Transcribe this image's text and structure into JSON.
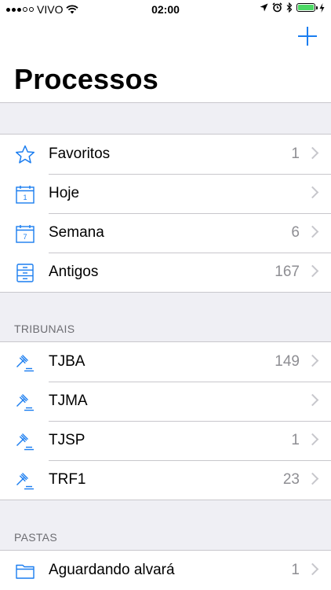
{
  "status_bar": {
    "carrier": "VIVO",
    "time": "02:00"
  },
  "nav": {
    "title": "Processos",
    "add_icon": "plus-icon"
  },
  "groups": {
    "main": [
      {
        "label": "Favoritos",
        "count": "1",
        "icon": "star-icon"
      },
      {
        "label": "Hoje",
        "count": "",
        "icon": "calendar-1-icon",
        "day": "1"
      },
      {
        "label": "Semana",
        "count": "6",
        "icon": "calendar-7-icon",
        "day": "7"
      },
      {
        "label": "Antigos",
        "count": "167",
        "icon": "cabinet-icon"
      }
    ],
    "tribunais_header": "TRIBUNAIS",
    "tribunais": [
      {
        "label": "TJBA",
        "count": "149",
        "icon": "gavel-icon"
      },
      {
        "label": "TJMA",
        "count": "",
        "icon": "gavel-icon"
      },
      {
        "label": "TJSP",
        "count": "1",
        "icon": "gavel-icon"
      },
      {
        "label": "TRF1",
        "count": "23",
        "icon": "gavel-icon"
      }
    ],
    "pastas_header": "PASTAS",
    "pastas": [
      {
        "label": "Aguardando alvará",
        "count": "1",
        "icon": "folder-icon"
      }
    ]
  },
  "colors": {
    "accent": "#1a7df0",
    "background": "#efeff4",
    "secondary_text": "#8e8e93"
  }
}
